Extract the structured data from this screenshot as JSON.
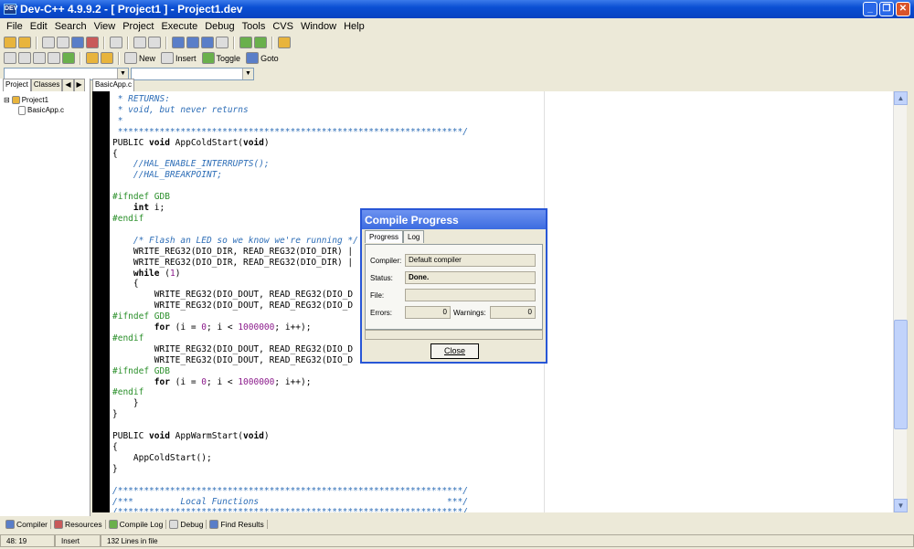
{
  "window": {
    "title": "Dev-C++ 4.9.9.2  -  [ Project1 ] - Project1.dev",
    "icon_text": "DEV"
  },
  "menu": [
    "File",
    "Edit",
    "Search",
    "View",
    "Project",
    "Execute",
    "Debug",
    "Tools",
    "CVS",
    "Window",
    "Help"
  ],
  "toolbar2": {
    "new": "New",
    "insert": "Insert",
    "toggle": "Toggle",
    "goto": "Goto"
  },
  "left_tabs": [
    "Project",
    "Classes"
  ],
  "tree": {
    "project": "Project1",
    "file": "BasicApp.c"
  },
  "editor_tab": "BasicApp.c",
  "bottom_tabs": [
    "Compiler",
    "Resources",
    "Compile Log",
    "Debug",
    "Find Results"
  ],
  "status": {
    "position": "48: 19",
    "mode": "Insert",
    "lines": "132 Lines in file"
  },
  "dialog": {
    "title": "Compile Progress",
    "tabs": [
      "Progress",
      "Log"
    ],
    "compiler_label": "Compiler:",
    "compiler_value": "Default compiler",
    "status_label": "Status:",
    "status_value": "Done.",
    "file_label": "File:",
    "file_value": "",
    "errors_label": "Errors:",
    "errors_value": "0",
    "warnings_label": "Warnings:",
    "warnings_value": "0",
    "close_label": "Close"
  }
}
